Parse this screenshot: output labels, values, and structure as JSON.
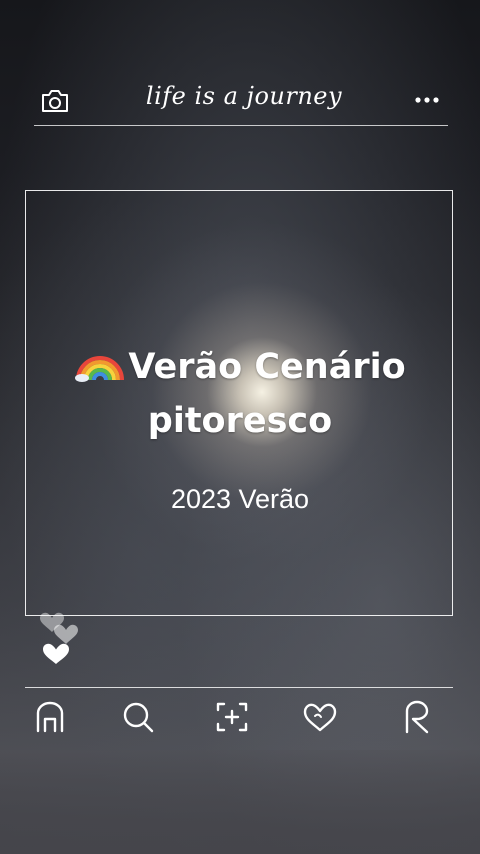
{
  "header": {
    "title": "life is a journey",
    "left_icon": "camera-icon",
    "right_icon": "more-options-icon"
  },
  "card": {
    "emoji_icon": "rainbow-icon",
    "headline_line1": "Verão Cenário",
    "headline_line2": "pitoresco",
    "subtitle": "2023 Verão"
  },
  "decor": {
    "hearts_icon": "hearts-icon"
  },
  "nav": {
    "items": [
      {
        "icon": "home-icon"
      },
      {
        "icon": "search-icon"
      },
      {
        "icon": "add-photo-icon"
      },
      {
        "icon": "heart-icon"
      },
      {
        "icon": "profile-icon"
      }
    ]
  },
  "colors": {
    "text": "#ffffff",
    "frame": "#ffffff",
    "background": "#2b2b30"
  }
}
